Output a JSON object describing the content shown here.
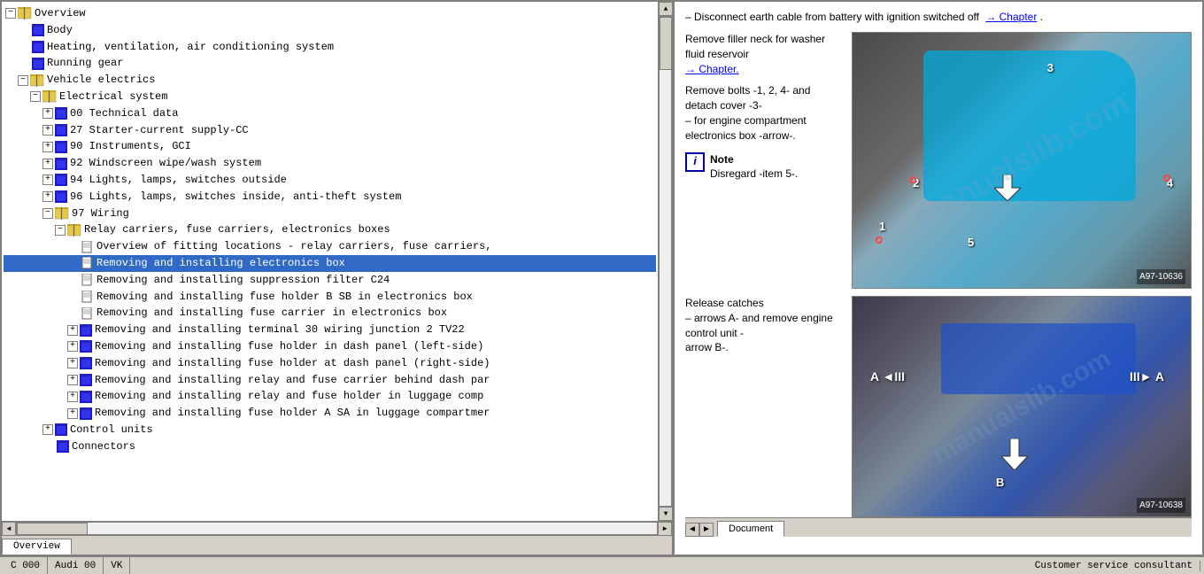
{
  "left_panel": {
    "tree_items": [
      {
        "id": "overview",
        "text": "Overview",
        "level": 0,
        "type": "book",
        "expandable": true,
        "expanded": true
      },
      {
        "id": "body",
        "text": "Body",
        "level": 1,
        "type": "blue",
        "expandable": false
      },
      {
        "id": "hvac",
        "text": "Heating, ventilation, air conditioning system",
        "level": 1,
        "type": "blue",
        "expandable": false
      },
      {
        "id": "running",
        "text": "Running gear",
        "level": 1,
        "type": "blue",
        "expandable": false
      },
      {
        "id": "electrics",
        "text": "Vehicle electrics",
        "level": 1,
        "type": "book",
        "expandable": true,
        "expanded": true
      },
      {
        "id": "elec-system",
        "text": "Electrical system",
        "level": 2,
        "type": "book",
        "expandable": true,
        "expanded": true
      },
      {
        "id": "00-tech",
        "text": "00  Technical data",
        "level": 3,
        "type": "blue",
        "expandable": true
      },
      {
        "id": "27-starter",
        "text": "27  Starter-current supply-CC",
        "level": 3,
        "type": "blue",
        "expandable": true
      },
      {
        "id": "90-inst",
        "text": "90  Instruments, GCI",
        "level": 3,
        "type": "blue",
        "expandable": true
      },
      {
        "id": "92-wiper",
        "text": "92  Windscreen wipe/wash system",
        "level": 3,
        "type": "blue",
        "expandable": true
      },
      {
        "id": "94-lights-out",
        "text": "94  Lights, lamps, switches outside",
        "level": 3,
        "type": "blue",
        "expandable": true
      },
      {
        "id": "96-lights-in",
        "text": "96  Lights, lamps, switches inside, anti-theft system",
        "level": 3,
        "type": "blue",
        "expandable": true
      },
      {
        "id": "97-wiring",
        "text": "97  Wiring",
        "level": 3,
        "type": "book",
        "expandable": true,
        "expanded": true
      },
      {
        "id": "relay-carriers",
        "text": "Relay carriers, fuse carriers, electronics boxes",
        "level": 4,
        "type": "book",
        "expandable": true,
        "expanded": true
      },
      {
        "id": "overview-fitting",
        "text": "Overview of fitting locations - relay carriers, fuse carriers,",
        "level": 5,
        "type": "doc"
      },
      {
        "id": "removing-elec-box",
        "text": "Removing and installing electronics box",
        "level": 5,
        "type": "doc",
        "selected": true
      },
      {
        "id": "removing-suppress",
        "text": "Removing and installing suppression filter C24",
        "level": 5,
        "type": "doc"
      },
      {
        "id": "removing-fuse-b-sb",
        "text": "Removing and installing fuse holder B SB in electronics box",
        "level": 5,
        "type": "doc"
      },
      {
        "id": "removing-fuse-carrier",
        "text": "Removing and installing fuse carrier in electronics box",
        "level": 5,
        "type": "doc"
      },
      {
        "id": "removing-terminal30",
        "text": "Removing and installing terminal 30 wiring junction 2 TV22",
        "level": 5,
        "type": "blue",
        "expandable": true
      },
      {
        "id": "removing-fuse-left",
        "text": "Removing and installing fuse holder in dash panel (left-side)",
        "level": 5,
        "type": "blue",
        "expandable": true
      },
      {
        "id": "removing-fuse-right",
        "text": "Removing and installing fuse holder at dash panel (right-side)",
        "level": 5,
        "type": "blue",
        "expandable": true
      },
      {
        "id": "removing-relay-dash",
        "text": "Removing and installing relay and fuse carrier behind dash par",
        "level": 5,
        "type": "blue",
        "expandable": true
      },
      {
        "id": "removing-relay-lug",
        "text": "Removing and installing relay and fuse holder in luggage comp",
        "level": 5,
        "type": "blue",
        "expandable": true
      },
      {
        "id": "removing-fuse-a-sa",
        "text": "Removing and installing fuse holder A SA in luggage compartmer",
        "level": 5,
        "type": "blue",
        "expandable": true
      },
      {
        "id": "control-units",
        "text": "Control units",
        "level": 3,
        "type": "blue",
        "expandable": true
      },
      {
        "id": "connectors",
        "text": "Connectors",
        "level": 3,
        "type": "blue",
        "expandable": false
      }
    ],
    "tabs": [
      {
        "id": "overview",
        "label": "Overview",
        "active": true
      }
    ]
  },
  "right_panel": {
    "content": {
      "intro": "– Disconnect earth cable from battery with ignition switched off",
      "chapter_link": "→ Chapter",
      "step1": {
        "text": "Remove filler neck for washer fluid reservoir",
        "link": "→ Chapter."
      },
      "step2": {
        "text": "Remove bolts -1, 2, 4- and detach cover -3- for engine compartment electronics box -arrow-."
      },
      "note": {
        "label": "Note",
        "text": "Disregard -item 5-."
      },
      "step3": {
        "text": "Release catches – arrows A- and remove engine control unit - arrow B-."
      },
      "image1_ref": "A97-10636",
      "image2_ref": "A97-10638",
      "labels": {
        "num1": "1",
        "num2": "2",
        "num3": "3",
        "num4": "4",
        "num5": "5",
        "arrow_a_left": "A ◄III",
        "arrow_a_right": "III► A",
        "arrow_b": "▼ B"
      }
    },
    "tabs": [
      {
        "id": "document",
        "label": "Document",
        "active": true
      }
    ]
  },
  "status_bar": {
    "left_text": "",
    "code": "C 000",
    "vehicle": "Audi 00",
    "transmission": "VK",
    "right_text": "Customer service consultant"
  },
  "nav": {
    "prev": "◄",
    "next": "►"
  }
}
